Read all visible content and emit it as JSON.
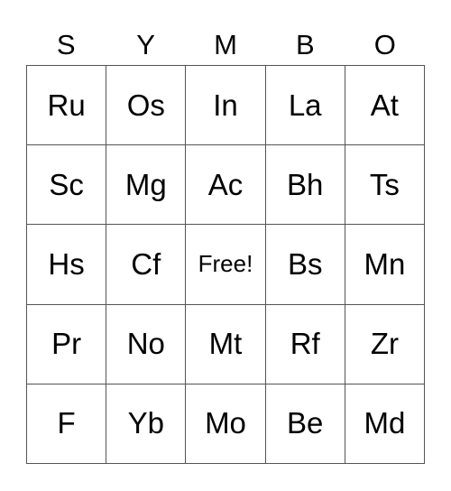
{
  "header": [
    "S",
    "Y",
    "M",
    "B",
    "O"
  ],
  "cells": [
    [
      "Ru",
      "Os",
      "In",
      "La",
      "At"
    ],
    [
      "Sc",
      "Mg",
      "Ac",
      "Bh",
      "Ts"
    ],
    [
      "Hs",
      "Cf",
      "Free!",
      "Bs",
      "Mn"
    ],
    [
      "Pr",
      "No",
      "Mt",
      "Rf",
      "Zr"
    ],
    [
      "F",
      "Yb",
      "Mo",
      "Be",
      "Md"
    ]
  ]
}
